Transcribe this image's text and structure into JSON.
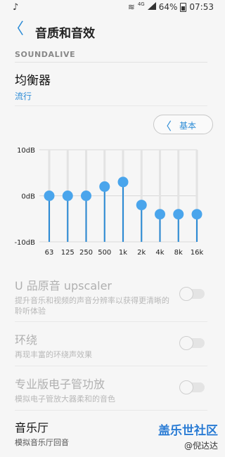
{
  "status": {
    "music_glyph": "♪",
    "wifi_glyph": "≋",
    "network": "4G",
    "battery": "64%",
    "time": "07:53"
  },
  "app_bar": {
    "back_glyph": "〈",
    "title": "音质和音效"
  },
  "section": {
    "header": "SOUNDALIVE"
  },
  "equalizer": {
    "title": "均衡器",
    "preset": "流行",
    "preset_button": {
      "chevron": "〈",
      "label": "基本"
    }
  },
  "chart_data": {
    "type": "line",
    "categories": [
      "63",
      "125",
      "250",
      "500",
      "1k",
      "2k",
      "4k",
      "8k",
      "16k"
    ],
    "values": [
      0,
      0,
      0,
      2,
      3,
      -2,
      -4,
      -4,
      -4
    ],
    "ylim": [
      -10,
      10
    ],
    "ytick_labels": [
      "10dB",
      "0dB",
      "-10dB"
    ],
    "colors": {
      "accent": "#2b8bd6",
      "knob": "#4aa5ec"
    }
  },
  "settings": [
    {
      "title": "U 品原音 upscaler",
      "desc": "提升音乐和视频的声音分辨率以获得更清晰的聆听体验",
      "enabled": false
    },
    {
      "title": "环绕",
      "desc": "再现丰富的环绕声效果",
      "enabled": false
    },
    {
      "title": "专业版电子管功放",
      "desc": "模拟电子管放大器柔和的音色",
      "enabled": false
    },
    {
      "title": "音乐厅",
      "desc": "模拟音乐厅回音",
      "enabled": true
    }
  ],
  "watermark": {
    "logo": "盖乐世社区",
    "user": "@倪达达"
  }
}
